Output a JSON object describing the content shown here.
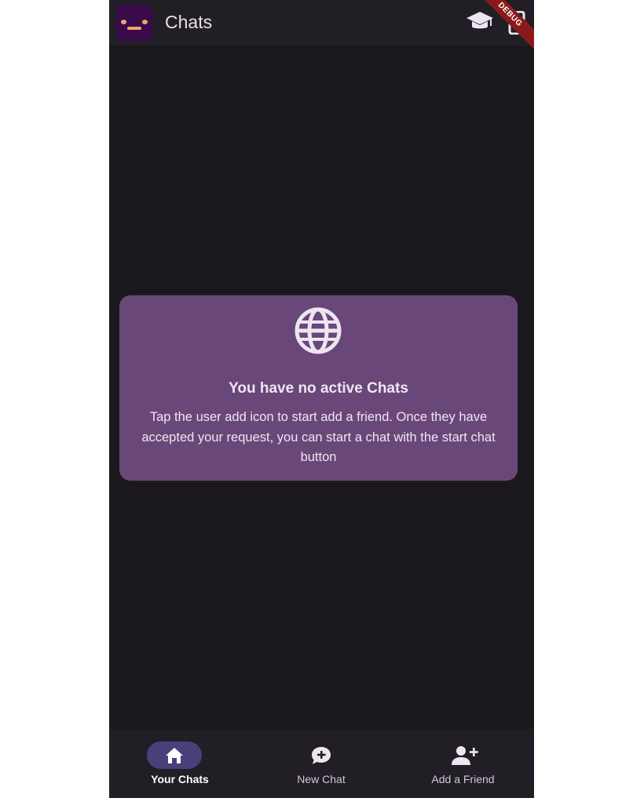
{
  "app_bar": {
    "title": "Chats",
    "logo_icon": "app-logo-icon",
    "actions": [
      "graduation-cap-icon",
      "phone-icon"
    ],
    "debug_banner": "DEBUG"
  },
  "empty_state": {
    "icon": "globe-icon",
    "title": "You have no active Chats",
    "message": "Tap the user add icon to start add a friend. Once they have accepted your request, you can start a chat with the start chat button"
  },
  "bottom_nav": {
    "items": [
      {
        "label": "Your Chats",
        "icon": "home-icon",
        "active": true
      },
      {
        "label": "New Chat",
        "icon": "chat-add-icon",
        "active": false
      },
      {
        "label": "Add a Friend",
        "icon": "person-add-icon",
        "active": false
      }
    ]
  },
  "colors": {
    "background": "#1b181d",
    "bar": "#211e26",
    "card": "#6a4779",
    "active_pill": "#4a3f7a",
    "debug": "#8a1a1a"
  }
}
